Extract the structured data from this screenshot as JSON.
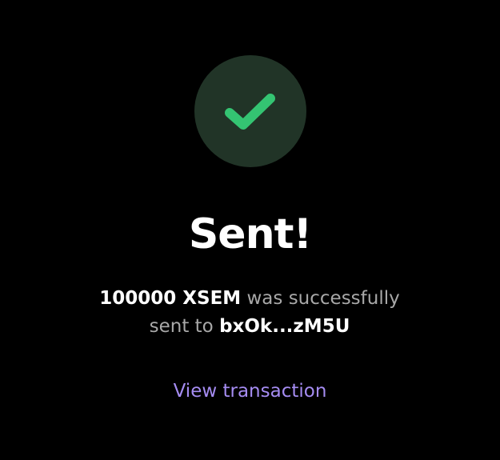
{
  "status_icon": {
    "name": "checkmark-icon",
    "color": "#34c472",
    "circle_color": "#213427"
  },
  "title": "Sent!",
  "message": {
    "amount": "100000 XSEM",
    "middle_text": "was successfully sent to",
    "recipient": "bxOk...zM5U"
  },
  "view_transaction_label": "View transaction",
  "colors": {
    "background": "#000000",
    "text_primary": "#ffffff",
    "text_secondary": "#a8a8a8",
    "link": "#a58cf2"
  }
}
